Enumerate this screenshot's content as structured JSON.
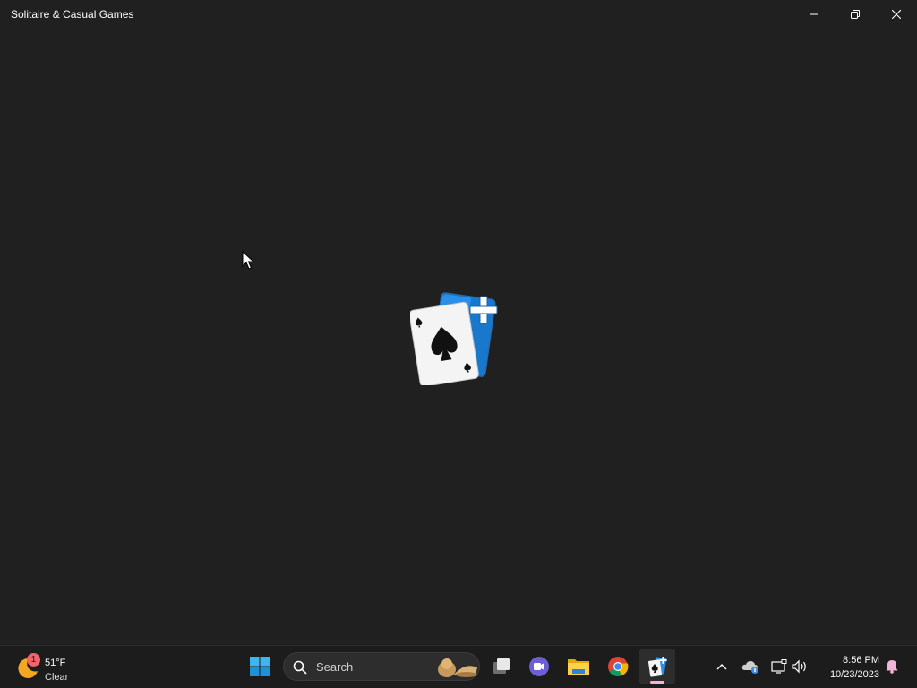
{
  "window": {
    "title": "Solitaire & Casual Games",
    "controls": {
      "minimize_icon": "minimize-icon",
      "restore_icon": "restore-icon",
      "close_icon": "close-icon"
    },
    "background": "#202020"
  },
  "splash": {
    "icon": "solitaire-app-logo",
    "colors": {
      "card_back": "#1a8fe0",
      "card_face": "#f2f2f2",
      "suit": "#111111"
    }
  },
  "taskbar": {
    "weather": {
      "badge": "1",
      "temperature": "51°F",
      "condition": "Clear",
      "icon": "moon-icon"
    },
    "start_icon": "windows-start-icon",
    "search": {
      "label": "Search",
      "icon": "search-icon"
    },
    "pinned_apps": [
      {
        "name": "task-view",
        "icon": "task-view-icon"
      },
      {
        "name": "teams",
        "icon": "teams-icon"
      },
      {
        "name": "file-explorer",
        "icon": "folder-icon"
      },
      {
        "name": "chrome",
        "icon": "chrome-icon"
      },
      {
        "name": "solitaire",
        "icon": "solitaire-icon",
        "active": true
      }
    ],
    "tray": {
      "overflow_icon": "chevron-up-icon",
      "onedrive_icon": "onedrive-icon",
      "network_icon": "network-icon",
      "volume_icon": "volume-icon",
      "notification_icon": "bell-icon"
    },
    "clock": {
      "time": "8:56 PM",
      "date": "10/23/2023"
    },
    "accent": "#f1b5d8"
  }
}
